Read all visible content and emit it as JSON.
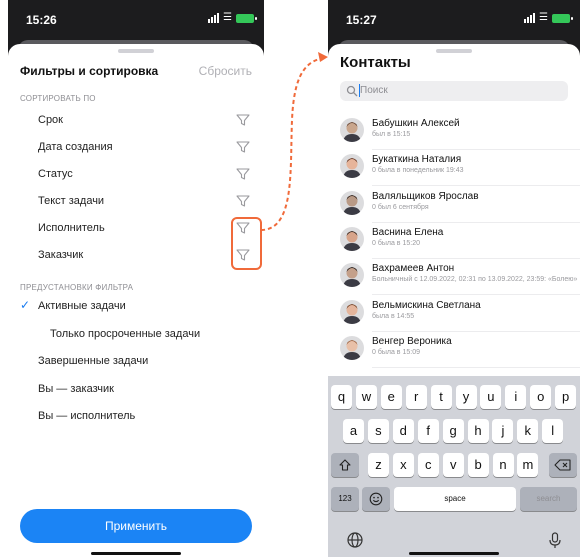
{
  "left_phone": {
    "time": "15:26",
    "title": "Фильтры и сортировка",
    "reset": "Сбросить",
    "sort_section": "СОРТИРОВАТЬ ПО",
    "sort_items": [
      "Срок",
      "Дата создания",
      "Статус",
      "Текст задачи",
      "Исполнитель",
      "Заказчик"
    ],
    "preset_section": "ПРЕДУСТАНОВКИ ФИЛЬТРА",
    "presets": [
      "Активные задачи",
      "Только просроченные задачи",
      "Завершенные задачи",
      "Вы — заказчик",
      "Вы — исполнитель"
    ],
    "selected_preset": "Активные задачи",
    "apply": "Применить"
  },
  "right_phone": {
    "time": "15:27",
    "title": "Контакты",
    "search_placeholder": "Поиск",
    "contacts": [
      {
        "name": "Бабушкин Алексей",
        "status": "был в 15:15"
      },
      {
        "name": "Букаткина Наталия",
        "status": "0 была в понедельник 19:43"
      },
      {
        "name": "Валяльщиков Ярослав",
        "status": "0 был 6 сентября"
      },
      {
        "name": "Васнина Елена",
        "status": "0 была в 15:20"
      },
      {
        "name": "Вахрамеев Антон",
        "status": "Больничный с 12.09.2022, 02:31 по 13.09.2022, 23:59: «Болею»"
      },
      {
        "name": "Вельмискина Светлана",
        "status": "была в 14:55"
      },
      {
        "name": "Венгер Вероника",
        "status": "0 была в 15:09"
      }
    ],
    "keyboard": {
      "row1": [
        "q",
        "w",
        "e",
        "r",
        "t",
        "y",
        "u",
        "i",
        "o",
        "p"
      ],
      "row2": [
        "a",
        "s",
        "d",
        "f",
        "g",
        "h",
        "j",
        "k",
        "l"
      ],
      "row3": [
        "z",
        "x",
        "c",
        "v",
        "b",
        "n",
        "m"
      ],
      "numbers": "123",
      "space": "space",
      "search": "search"
    }
  },
  "colors": {
    "accent": "#1b84f5",
    "highlight": "#f06a3a",
    "keyboard_bg": "#d1d3d9"
  }
}
